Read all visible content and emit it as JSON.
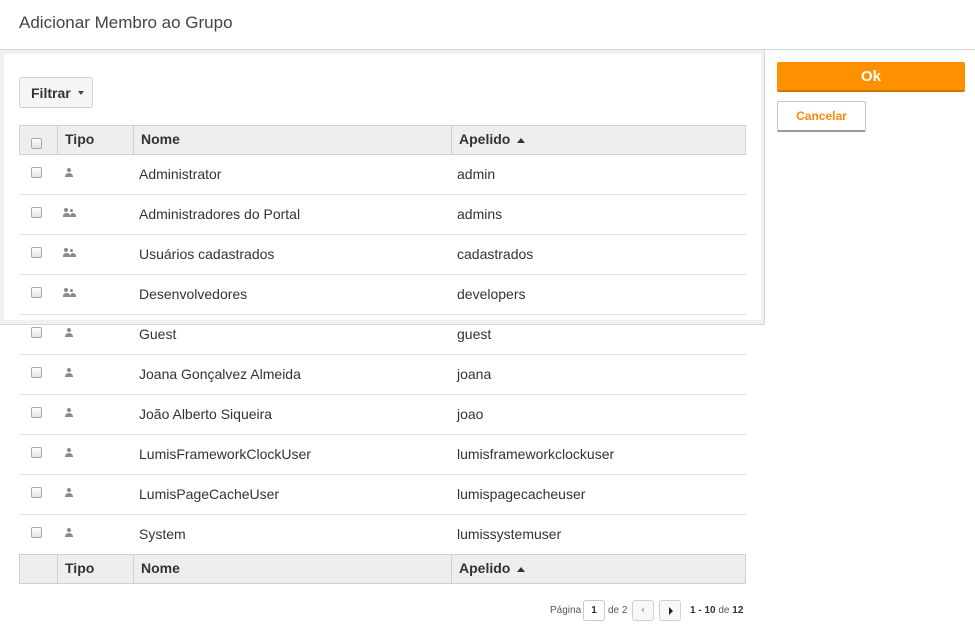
{
  "dialog": {
    "title": "Adicionar Membro ao Grupo"
  },
  "toolbar": {
    "filter_label": "Filtrar"
  },
  "actions": {
    "ok_label": "Ok",
    "cancel_label": "Cancelar"
  },
  "columns": {
    "type": "Tipo",
    "name": "Nome",
    "alias": "Apelido",
    "sort": "ascending"
  },
  "rows": [
    {
      "type": "user-icon",
      "name": "Administrator",
      "alias": "admin"
    },
    {
      "type": "group-icon",
      "name": "Administradores do Portal",
      "alias": "admins"
    },
    {
      "type": "group-icon",
      "name": "Usuários cadastrados",
      "alias": "cadastrados"
    },
    {
      "type": "group-icon",
      "name": "Desenvolvedores",
      "alias": "developers"
    },
    {
      "type": "user-icon",
      "name": "Guest",
      "alias": "guest"
    },
    {
      "type": "user-icon",
      "name": "Joana Gonçalvez Almeida",
      "alias": "joana"
    },
    {
      "type": "user-icon",
      "name": "João Alberto Siqueira",
      "alias": "joao"
    },
    {
      "type": "user-icon",
      "name": "LumisFrameworkClockUser",
      "alias": "lumisframeworkclockuser"
    },
    {
      "type": "user-icon",
      "name": "LumisPageCacheUser",
      "alias": "lumispagecacheuser"
    },
    {
      "type": "user-icon",
      "name": "System",
      "alias": "lumissystemuser"
    }
  ],
  "pager": {
    "label": "Página",
    "current": "1",
    "of_label": "de 2",
    "range_start": "1",
    "range_sep": " - ",
    "range_end": "10",
    "range_of": " de ",
    "total": "12"
  },
  "colors": {
    "accent": "#ff9000",
    "cancel_text": "#ff8a00"
  }
}
